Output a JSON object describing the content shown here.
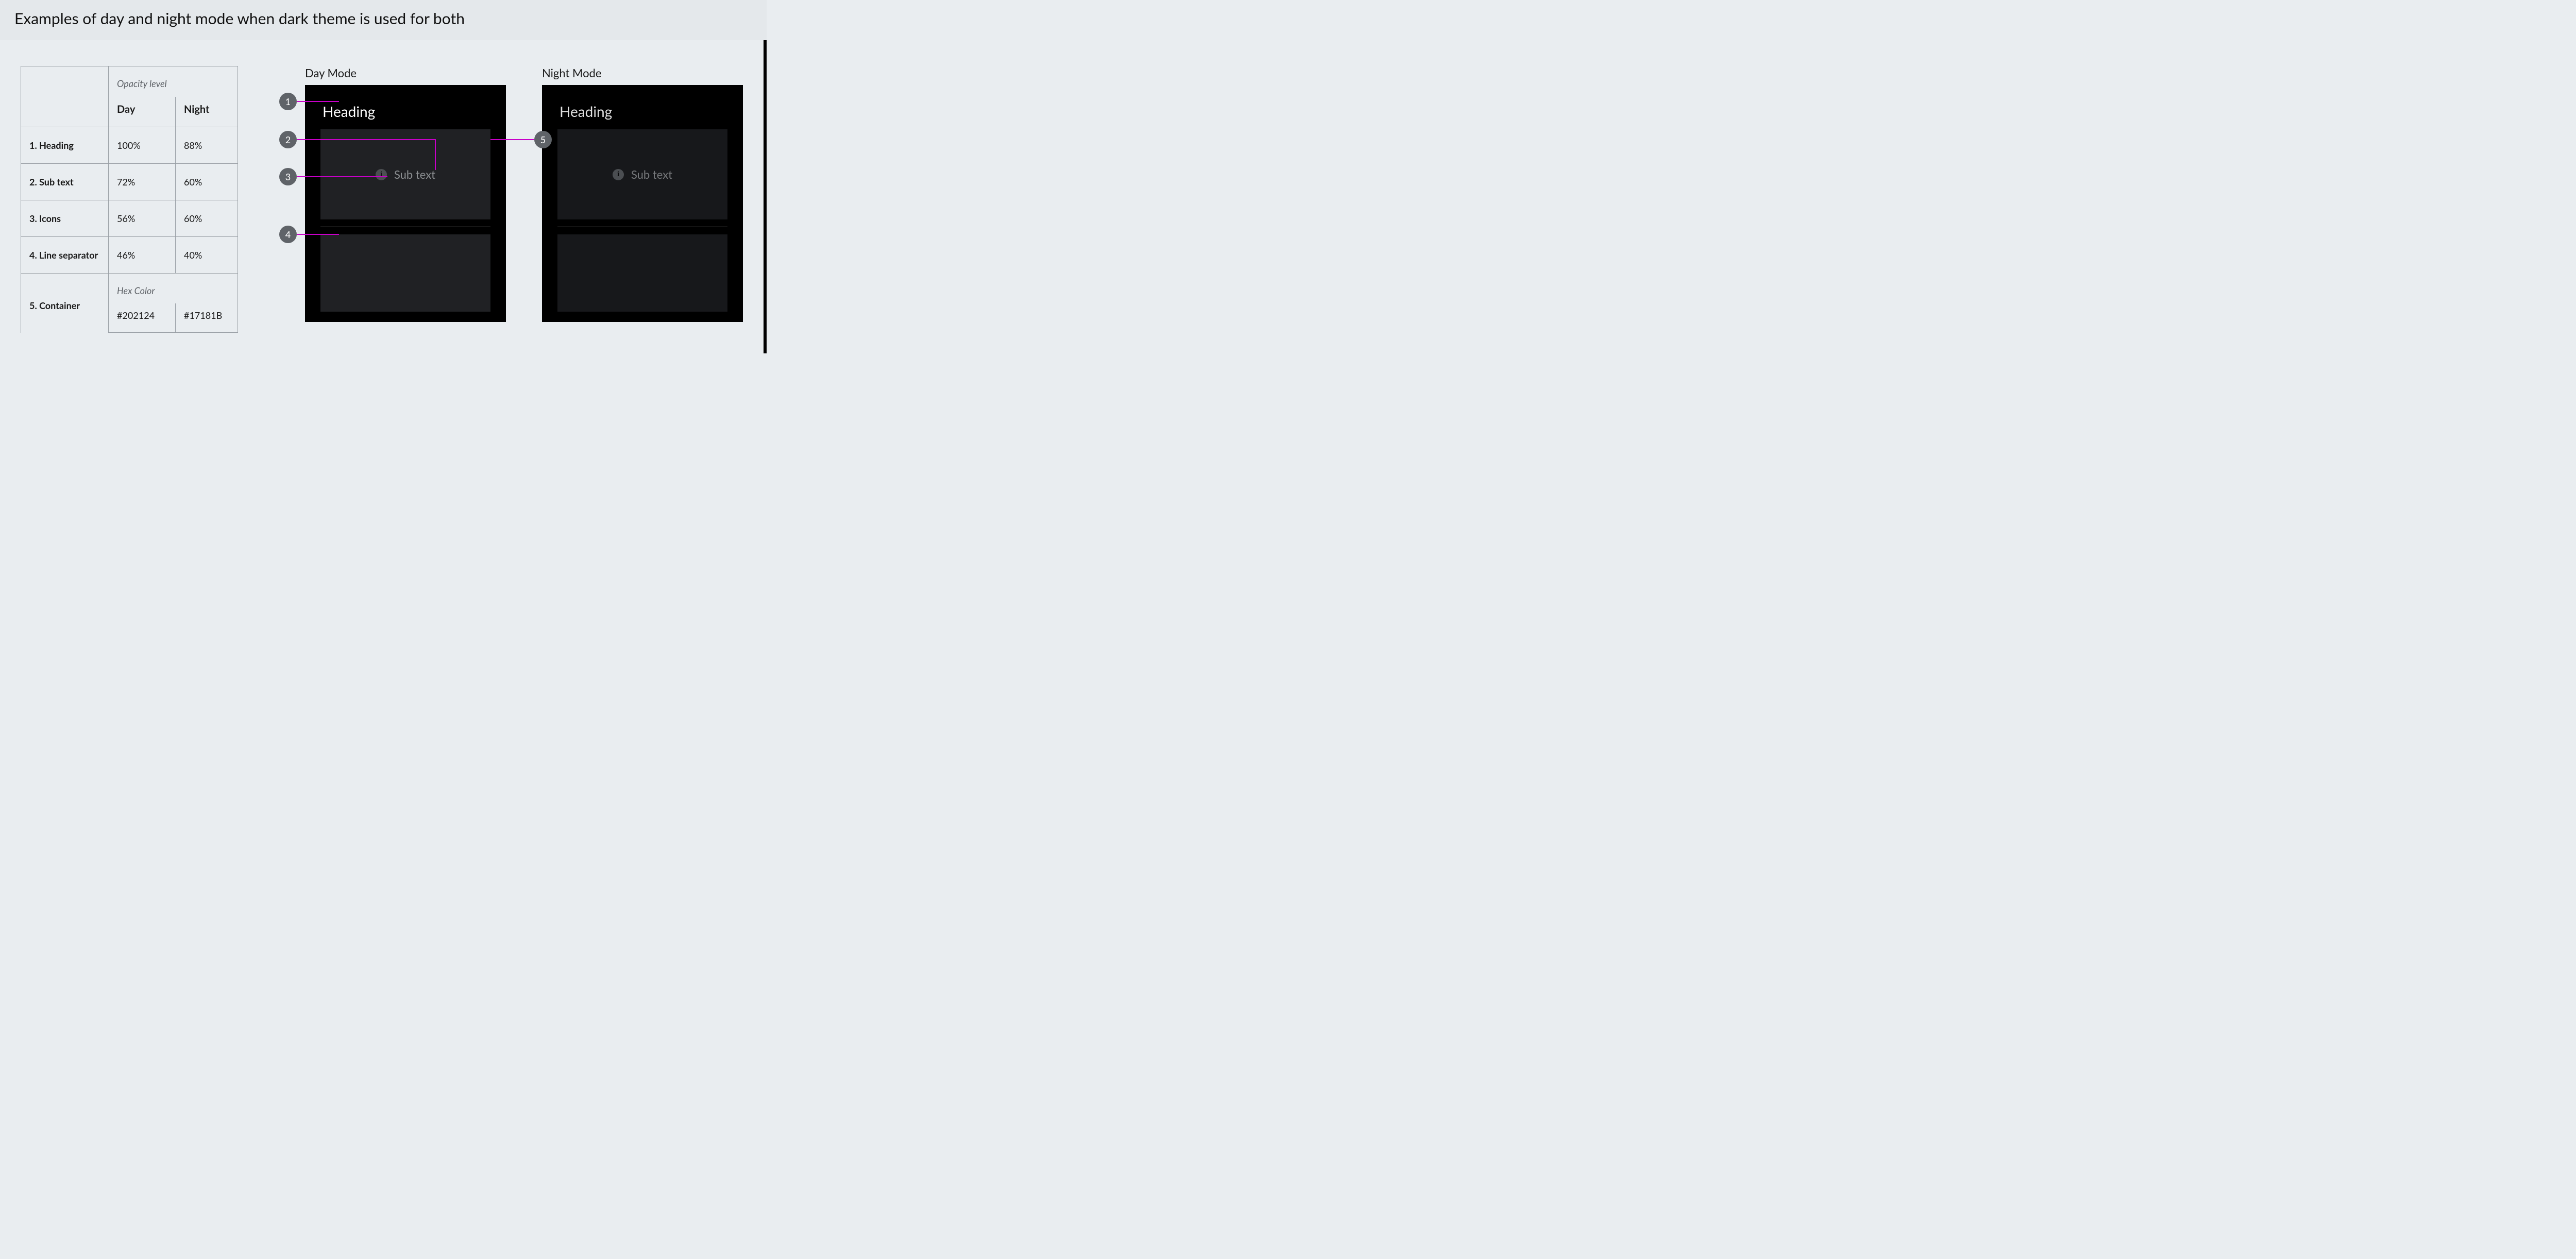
{
  "title": "Examples of day and night mode when dark theme is used for both",
  "table": {
    "header_note": "Opacity level",
    "col_day": "Day",
    "col_night": "Night",
    "rows": [
      {
        "label": "1. Heading",
        "day": "100%",
        "night": "88%"
      },
      {
        "label": "2. Sub text",
        "day": "72%",
        "night": "60%"
      },
      {
        "label": "3. Icons",
        "day": "56%",
        "night": "60%"
      },
      {
        "label": "4. Line separator",
        "day": "46%",
        "night": "40%"
      }
    ],
    "hex_note": "Hex Color",
    "container_row": {
      "label": "5. Container",
      "day": "#202124",
      "night": "#17181B"
    }
  },
  "preview": {
    "day": {
      "label": "Day Mode",
      "heading": "Heading",
      "subtext": "Sub text",
      "container_color": "#202124",
      "heading_opacity": 1.0,
      "subtext_opacity": 0.72,
      "icon_opacity": 0.56,
      "sep_opacity": 0.46
    },
    "night": {
      "label": "Night Mode",
      "heading": "Heading",
      "subtext": "Sub text",
      "container_color": "#17181B",
      "heading_opacity": 0.88,
      "subtext_opacity": 0.6,
      "icon_opacity": 0.6,
      "sep_opacity": 0.4
    }
  },
  "annotations": {
    "b1": "1",
    "b2": "2",
    "b3": "3",
    "b4": "4",
    "b5": "5"
  }
}
